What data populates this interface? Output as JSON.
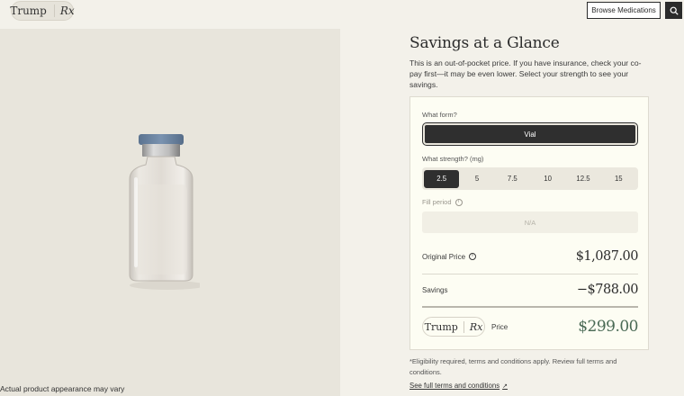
{
  "header": {
    "logo_word": "Trump",
    "logo_rx": "Rx",
    "browse_label": "Browse Medications",
    "search_icon": "search-icon"
  },
  "product": {
    "image_caption": "Actual product appearance may vary"
  },
  "savings": {
    "title": "Savings at a Glance",
    "intro": "This is an out-of-pocket price. If you have insurance, check your co-pay first—it may be even lower. Select your strength to see your savings.",
    "form_label": "What form?",
    "form_selected": "Vial",
    "strength_label": "What strength? (mg)",
    "strengths": [
      "2.5",
      "5",
      "7.5",
      "10",
      "12.5",
      "15"
    ],
    "strength_selected": "2.5",
    "fill_label": "Fill period",
    "fill_value": "N/A",
    "original_label": "Original Price",
    "original_value": "$1,087.00",
    "savings_label": "Savings",
    "savings_value": "−$788.00",
    "final_logo_word": "Trump",
    "final_logo_rx": "Rx",
    "final_label": "Price",
    "final_value": "$299.00"
  },
  "footer": {
    "eligibility": "*Eligibility required, terms and conditions apply. Review full terms and conditions.",
    "terms_link": "See full terms and conditions"
  },
  "colors": {
    "accent_dark": "#2f2f2f",
    "price_green": "#4a6a55",
    "card_bg": "#fdfdf3"
  }
}
